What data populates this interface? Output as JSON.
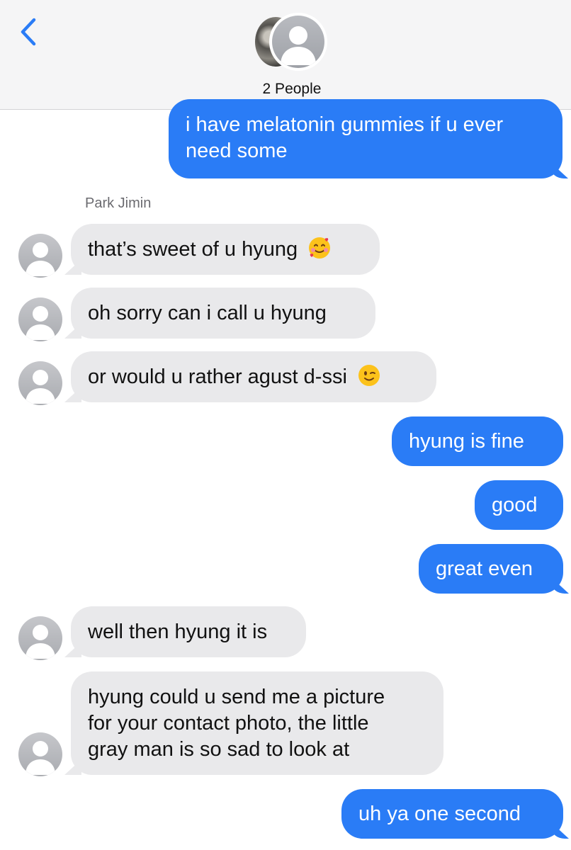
{
  "header": {
    "back_icon": "chevron-left-icon",
    "group_label": "2 People",
    "accent_color": "#2a7cf6"
  },
  "conversation": {
    "sender_name": "Park Jimin",
    "messages": [
      {
        "from": "me",
        "lines": [
          "i have melatonin gummies if u ever",
          "need some"
        ]
      },
      {
        "from": "Park Jimin",
        "lines": [
          "that’s sweet of u hyung"
        ],
        "emoji": "smiling-face-with-hearts-emoji"
      },
      {
        "from": "Park Jimin",
        "lines": [
          "oh sorry can i call u hyung"
        ]
      },
      {
        "from": "Park Jimin",
        "lines": [
          "or would u rather agust d-ssi"
        ],
        "emoji": "winking-face-emoji"
      },
      {
        "from": "me",
        "lines": [
          "hyung is fine"
        ]
      },
      {
        "from": "me",
        "lines": [
          "good"
        ]
      },
      {
        "from": "me",
        "lines": [
          "great even"
        ]
      },
      {
        "from": "Park Jimin",
        "lines": [
          "well then hyung it is"
        ]
      },
      {
        "from": "Park Jimin",
        "lines": [
          "hyung could u send me a picture",
          "for your contact photo, the little",
          "gray man is so sad to look at"
        ]
      },
      {
        "from": "me",
        "lines": [
          "uh ya one second"
        ]
      }
    ]
  },
  "colors": {
    "outgoing_bubble": "#2a7cf6",
    "incoming_bubble": "#e9e9eb"
  }
}
